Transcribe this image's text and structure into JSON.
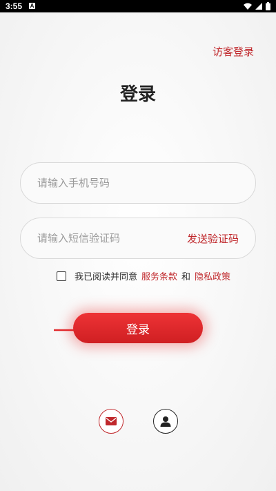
{
  "status_bar": {
    "time": "3:55",
    "notification_icon": "A"
  },
  "header": {
    "guest_login": "访客登录",
    "title": "登录"
  },
  "form": {
    "phone_placeholder": "请输入手机号码",
    "code_placeholder": "请输入短信验证码",
    "send_code": "发送验证码"
  },
  "agreement": {
    "prefix": "我已阅读并同意",
    "terms": "服务条款",
    "and": "和",
    "privacy": "隐私政策",
    "checked": false
  },
  "login_button": "登录",
  "bottom_icons": [
    "mail-icon",
    "user-icon"
  ],
  "colors": {
    "accent": "#c0282c",
    "button": "#e02b2e"
  }
}
